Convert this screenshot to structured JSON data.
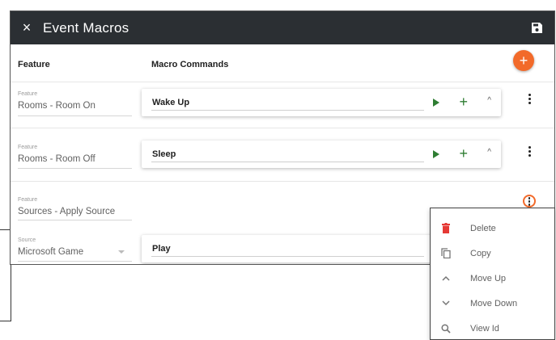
{
  "dialog": {
    "title": "Event Macros",
    "close_glyph": "×"
  },
  "columns": {
    "feature": "Feature",
    "macro_commands": "Macro Commands"
  },
  "add_button": {
    "glyph": "+"
  },
  "rows": [
    {
      "feature_label": "Feature",
      "feature_value": "Rooms - Room On",
      "command": "Wake Up"
    },
    {
      "feature_label": "Feature",
      "feature_value": "Rooms - Room Off",
      "command": "Sleep"
    },
    {
      "feature_label": "Feature",
      "feature_value": "Sources - Apply Source",
      "source_label": "Source",
      "source_value": "Microsoft Game",
      "command": "Play"
    }
  ],
  "card_controls": {
    "add_glyph": "+",
    "collapse_glyph": "^"
  },
  "context_menu": {
    "items": [
      {
        "label": "Delete",
        "icon": "trash-icon"
      },
      {
        "label": "Copy",
        "icon": "copy-icon"
      },
      {
        "label": "Move Up",
        "icon": "chevron-up-icon"
      },
      {
        "label": "Move Down",
        "icon": "chevron-down-icon"
      },
      {
        "label": "View Id",
        "icon": "search-icon"
      }
    ]
  },
  "colors": {
    "titlebar": "#2b2f33",
    "accent": "#f26a2a",
    "play_green": "#2e7d32",
    "delete_red": "#e53935"
  }
}
